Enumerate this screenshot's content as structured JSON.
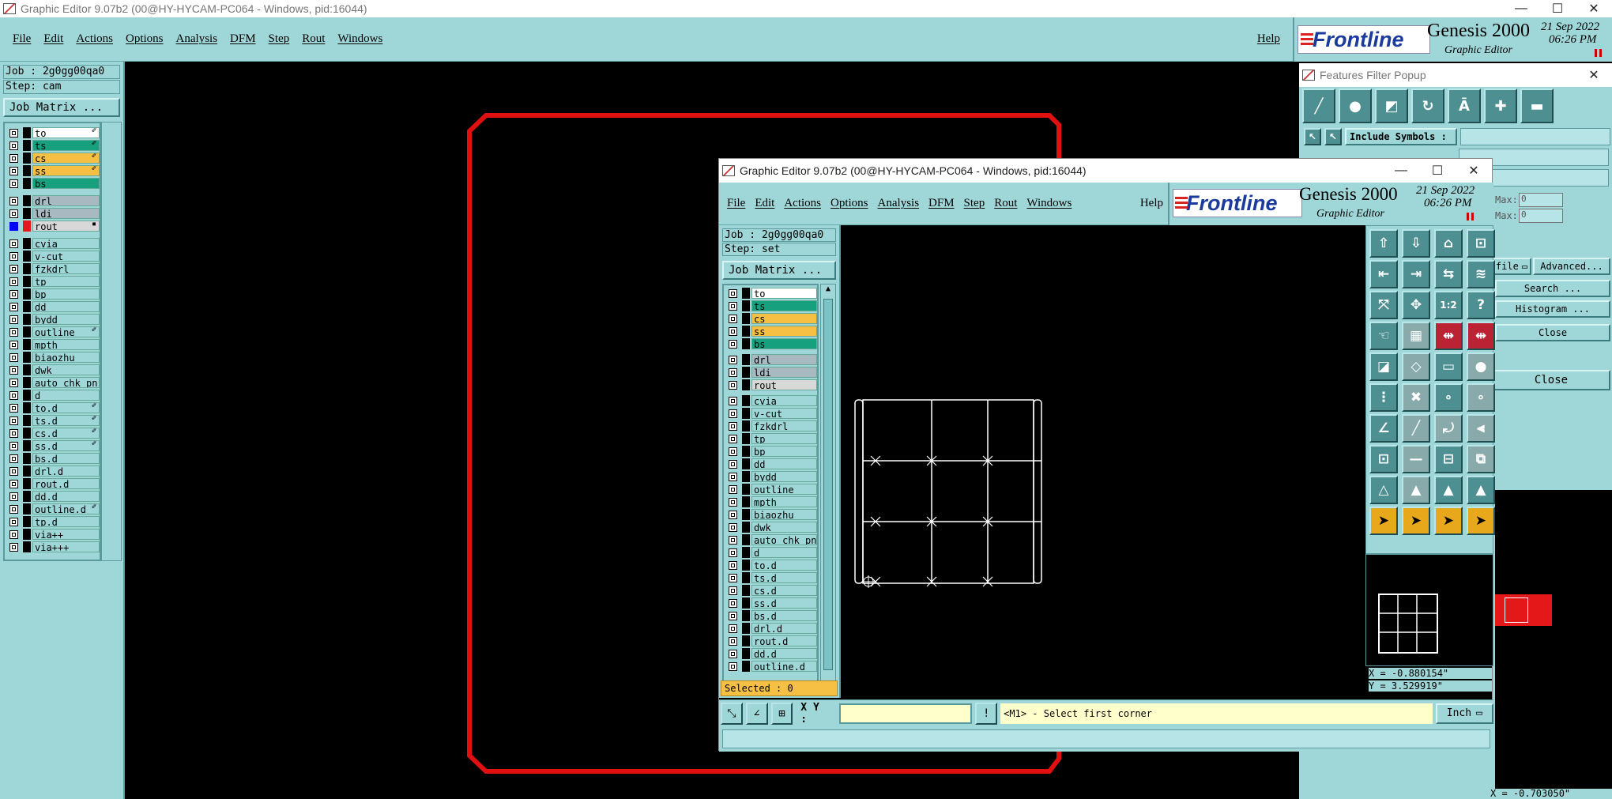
{
  "main_window": {
    "title": "Graphic Editor 9.07b2 (00@HY-HYCAM-PC064 - Windows, pid:16044)",
    "menu": [
      "File",
      "Edit",
      "Actions",
      "Options",
      "Analysis",
      "DFM",
      "Step",
      "Rout",
      "Windows"
    ],
    "help": "Help",
    "brand": "Frontline",
    "product": "Genesis 2000",
    "subtitle": "Graphic Editor",
    "date": "21 Sep 2022",
    "time": "06:26 PM",
    "job_label": "Job : 2g0gg00qa0",
    "step_label": "Step: cam",
    "job_matrix": "Job Matrix ..."
  },
  "layers_main": {
    "group1": [
      {
        "name": "to",
        "color": "#ffffff",
        "mark": "✐"
      },
      {
        "name": "ts",
        "color": "#17a07d",
        "mark": "✐"
      },
      {
        "name": "cs",
        "color": "#f5c043",
        "mark": "✐"
      },
      {
        "name": "ss",
        "color": "#f5c043",
        "mark": "✐"
      },
      {
        "name": "bs",
        "color": "#17a07d",
        "mark": ""
      }
    ],
    "group2": [
      {
        "name": "drl",
        "color": "#a9b9c2",
        "mark": ""
      },
      {
        "name": "ldi",
        "color": "#a9b9c2",
        "mark": ""
      },
      {
        "name": "rout",
        "color": "#d8d8d8",
        "mark": "▪",
        "selected": true
      }
    ],
    "group3": [
      {
        "name": "cvia",
        "mark": ""
      },
      {
        "name": "v-cut",
        "mark": ""
      },
      {
        "name": "fzkdrl",
        "mark": ""
      },
      {
        "name": "tp",
        "mark": ""
      },
      {
        "name": "bp",
        "mark": ""
      },
      {
        "name": "dd",
        "mark": ""
      },
      {
        "name": "bydd",
        "mark": ""
      },
      {
        "name": "outline",
        "mark": "✐"
      },
      {
        "name": "mpth",
        "mark": ""
      },
      {
        "name": "biaozhu",
        "mark": ""
      },
      {
        "name": "dwk",
        "mark": ""
      },
      {
        "name": "auto_chk_pn.",
        "mark": ""
      },
      {
        "name": "d",
        "mark": ""
      },
      {
        "name": "to.d",
        "mark": "✐"
      },
      {
        "name": "ts.d",
        "mark": "✐"
      },
      {
        "name": "cs.d",
        "mark": "✐"
      },
      {
        "name": "ss.d",
        "mark": "✐"
      },
      {
        "name": "bs.d",
        "mark": ""
      },
      {
        "name": "drl.d",
        "mark": ""
      },
      {
        "name": "rout.d",
        "mark": ""
      },
      {
        "name": "dd.d",
        "mark": ""
      },
      {
        "name": "outline.d",
        "mark": "✐"
      },
      {
        "name": "tp.d",
        "mark": ""
      },
      {
        "name": "via++",
        "mark": ""
      },
      {
        "name": "via+++",
        "mark": ""
      }
    ]
  },
  "filter_popup": {
    "title": "Features Filter Popup",
    "include_symbols": "Include Symbols :",
    "max1": "Max:",
    "max2": "Max:",
    "max_val": "0",
    "profile": "file",
    "advanced": "Advanced...",
    "search": "Search ...",
    "histogram": "Histogram ...",
    "close": "Close",
    "close2": "Close",
    "coord_partial": "X = -0.703050\""
  },
  "second_window": {
    "title": "Graphic Editor 9.07b2 (00@HY-HYCAM-PC064 - Windows, pid:16044)",
    "menu": [
      "File",
      "Edit",
      "Actions",
      "Options",
      "Analysis",
      "DFM",
      "Step",
      "Rout",
      "Windows"
    ],
    "help": "Help",
    "brand": "Frontline",
    "product": "Genesis 2000",
    "subtitle": "Graphic Editor",
    "date": "21 Sep 2022",
    "time": "06:26 PM",
    "job_label": "Job : 2g0gg00qa0",
    "step_label": "Step: set",
    "job_matrix": "Job Matrix ...",
    "selected": "Selected : 0",
    "xy_label": "X Y :",
    "prompt": "<M1> - Select first corner",
    "units": "Inch",
    "coord_x": "X = -0.880154\"",
    "coord_y": "Y = 3.529919\""
  },
  "layers_second": {
    "group1": [
      {
        "name": "to",
        "color": "#ffffff"
      },
      {
        "name": "ts",
        "color": "#17a07d"
      },
      {
        "name": "cs",
        "color": "#f5c043"
      },
      {
        "name": "ss",
        "color": "#f5c043"
      },
      {
        "name": "bs",
        "color": "#17a07d"
      }
    ],
    "group2": [
      {
        "name": "drl",
        "color": "#a9b9c2"
      },
      {
        "name": "ldi",
        "color": "#a9b9c2"
      },
      {
        "name": "rout",
        "color": "#d8d8d8"
      }
    ],
    "group3": [
      "cvia",
      "v-cut",
      "fzkdrl",
      "tp",
      "bp",
      "dd",
      "bydd",
      "outline",
      "mpth",
      "biaozhu",
      "dwk",
      "auto_chk_pn.",
      "d",
      "to.d",
      "ts.d",
      "cs.d",
      "ss.d",
      "bs.d",
      "drl.d",
      "rout.d",
      "dd.d",
      "outline.d"
    ]
  }
}
